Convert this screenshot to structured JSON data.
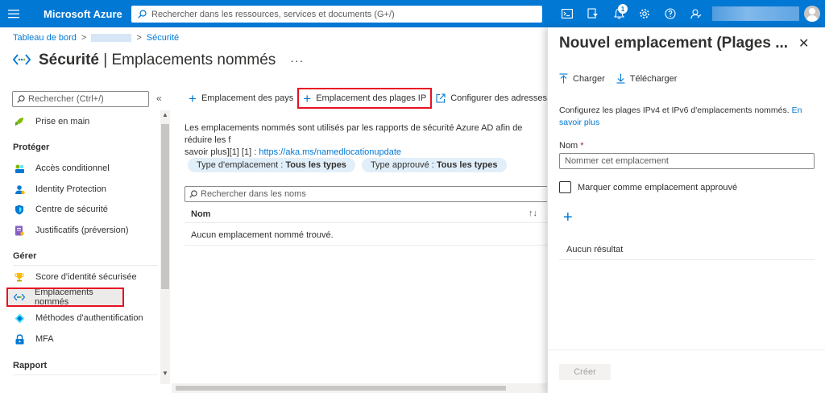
{
  "topbar": {
    "brand": "Microsoft Azure",
    "search_placeholder": "Rechercher dans les ressources, services et documents (G+/)",
    "notification_count": "1",
    "icons": [
      "cloud-shell-icon",
      "directory-filter-icon",
      "notifications-icon",
      "settings-icon",
      "help-icon",
      "feedback-icon"
    ]
  },
  "breadcrumb": {
    "root": "Tableau de bord",
    "current": "Sécurité"
  },
  "page": {
    "title_bold": "Sécurité",
    "title_sep": " | ",
    "title_rest": "Emplacements nommés",
    "more": "···"
  },
  "sidebar": {
    "search_placeholder": "Rechercher (Ctrl+/)",
    "collapse": "«",
    "getting_started": "Prise en main",
    "sections": {
      "protect": "Protéger",
      "manage": "Gérer",
      "report": "Rapport"
    },
    "protect_items": [
      "Accès conditionnel",
      "Identity Protection",
      "Centre de sécurité",
      "Justificatifs (préversion)"
    ],
    "manage_items": [
      "Score d'identité sécurisée",
      "Emplacements nommés",
      "Méthodes d'authentification",
      "MFA"
    ]
  },
  "toolbar": {
    "country_location": "Emplacement des pays",
    "ip_range_location": "Emplacement des plages IP",
    "configure_ips": "Configurer des adresses IP a"
  },
  "main": {
    "description": "Les emplacements nommés sont utilisés par les rapports de sécurité Azure AD afin de réduire les f",
    "description_2": "savoir plus][1] [1] : ",
    "link": "https://aka.ms/namedlocationupdate",
    "filter_type_label": "Type d'emplacement : ",
    "filter_type_value": "Tous les types",
    "filter_trusted_label": "Type approuvé : ",
    "filter_trusted_value": "Tous les types",
    "list_search_placeholder": "Rechercher dans les noms",
    "column_name": "Nom",
    "sort": "↑↓",
    "empty": "Aucun emplacement nommé trouvé."
  },
  "blade": {
    "title": "Nouvel emplacement (Plages ...",
    "close": "✕",
    "upload": "Charger",
    "download": "Télécharger",
    "description": "Configurez les plages IPv4 et IPv6 d'emplacements nommés. ",
    "learn_more": "En savoir plus",
    "name_label": "Nom",
    "required": "*",
    "name_placeholder": "Nommer cet emplacement",
    "trusted_checkbox": "Marquer comme emplacement approuvé",
    "add": "+",
    "no_result": "Aucun résultat",
    "create": "Créer"
  },
  "colors": {
    "accent": "#0078d4",
    "highlight": "#e81123"
  }
}
